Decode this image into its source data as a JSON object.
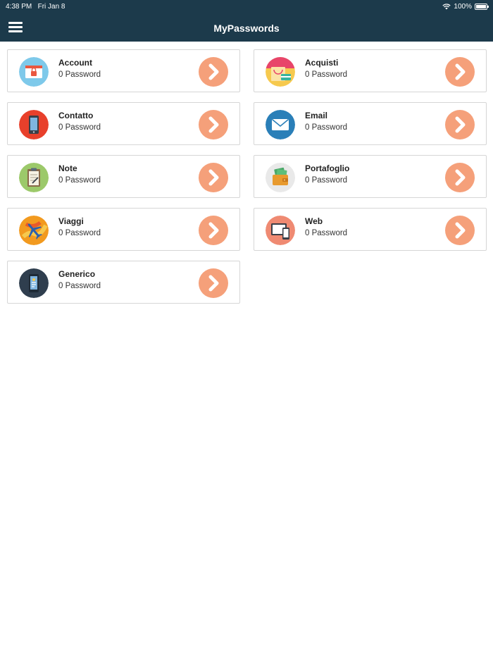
{
  "status_bar": {
    "time": "4:38 PM",
    "date": "Fri Jan 8",
    "battery": "100%"
  },
  "header": {
    "title": "MyPasswords"
  },
  "categories": [
    {
      "name": "Account",
      "count": "0 Password",
      "icon": "browser-lock-icon",
      "color": "#78c8e8"
    },
    {
      "name": "Acquisti",
      "count": "0 Password",
      "icon": "shopping-bag-icon",
      "color": "#f2b84b"
    },
    {
      "name": "Contatto",
      "count": "0 Password",
      "icon": "phone-icon",
      "color": "#e8402b"
    },
    {
      "name": "Email",
      "count": "0 Password",
      "icon": "envelope-icon",
      "color": "#2a7fb8"
    },
    {
      "name": "Note",
      "count": "0 Password",
      "icon": "clipboard-icon",
      "color": "#9cc96a"
    },
    {
      "name": "Portafoglio",
      "count": "0 Password",
      "icon": "wallet-icon",
      "color": "#e6e6e6"
    },
    {
      "name": "Viaggi",
      "count": "0 Password",
      "icon": "airplane-icon",
      "color": "#f29a1f"
    },
    {
      "name": "Web",
      "count": "0 Password",
      "icon": "devices-icon",
      "color": "#ef8a72"
    },
    {
      "name": "Generico",
      "count": "0 Password",
      "icon": "mobile-app-icon",
      "color": "#2f3e4e"
    }
  ],
  "colors": {
    "header_bg": "#1c3a4b",
    "arrow_bg": "#f5a07a"
  }
}
